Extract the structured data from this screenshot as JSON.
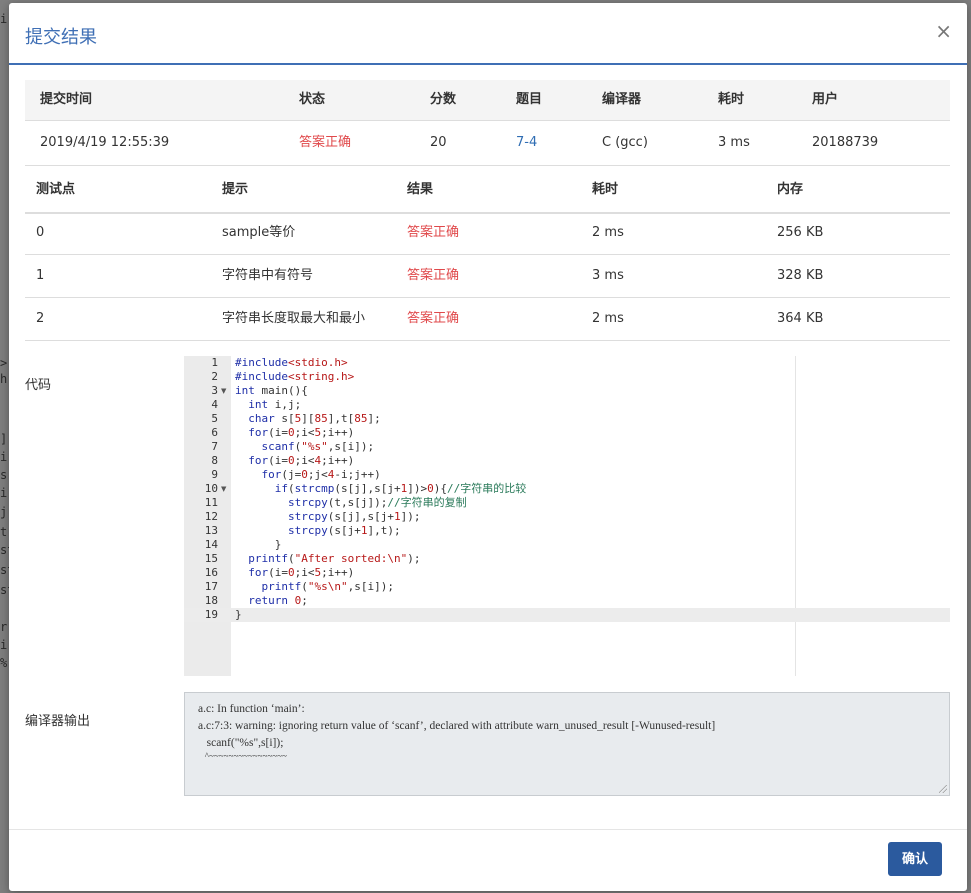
{
  "modal": {
    "title": "提交结果",
    "close_glyph": "×",
    "confirm_label": "确认"
  },
  "summary": {
    "headers": [
      "提交时间",
      "状态",
      "分数",
      "题目",
      "编译器",
      "耗时",
      "用户"
    ],
    "row": [
      "2019/4/19 12:55:39",
      "答案正确",
      "20",
      "7-4",
      "C (gcc)",
      "3 ms",
      "20188739"
    ]
  },
  "tests": {
    "headers": [
      "测试点",
      "提示",
      "结果",
      "耗时",
      "内存"
    ],
    "rows": [
      [
        "0",
        "sample等价",
        "答案正确",
        "2 ms",
        "256 KB"
      ],
      [
        "1",
        "字符串中有符号",
        "答案正确",
        "3 ms",
        "328 KB"
      ],
      [
        "2",
        "字符串长度取最大和最小",
        "答案正确",
        "2 ms",
        "364 KB"
      ]
    ]
  },
  "code_section": {
    "label": "代码",
    "line_numbers": [
      "1",
      "2",
      "3",
      "4",
      "5",
      "6",
      "7",
      "8",
      "9",
      "10",
      "11",
      "12",
      "13",
      "14",
      "15",
      "16",
      "17",
      "18",
      "19"
    ],
    "lines": [
      "#include<stdio.h>",
      "#include<string.h>",
      "int main(){",
      "  int i,j;",
      "  char s[5][85],t[85];",
      "  for(i=0;i<5;i++)",
      "    scanf(\"%s\",s[i]);",
      "  for(i=0;i<4;i++)",
      "    for(j=0;j<4-i;j++)",
      "      if(strcmp(s[j],s[j+1])>0){//字符串的比较",
      "        strcpy(t,s[j]);//字符串的复制",
      "        strcpy(s[j],s[j+1]);",
      "        strcpy(s[j+1],t);",
      "      }",
      "  printf(\"After sorted:\\n\");",
      "  for(i=0;i<5;i++)",
      "    printf(\"%s\\n\",s[i]);",
      "  return 0;",
      "}"
    ]
  },
  "compiler_section": {
    "label": "编译器输出",
    "lines": [
      "a.c: In function ‘main’:",
      "a.c:7:3: warning: ignoring return value of ‘scanf’, declared with attribute warn_unused_result [-Wunused-result]",
      "   scanf(\"%s\",s[i]);",
      "   ^~~~~~~~~~~~~~~~~"
    ]
  },
  "background_fragments": [
    "i",
    ">",
    "h",
    "].",
    "i-",
    "s",
    "i-",
    "j-",
    "tr",
    "st",
    "st",
    "st",
    "r",
    "i-",
    "%"
  ]
}
